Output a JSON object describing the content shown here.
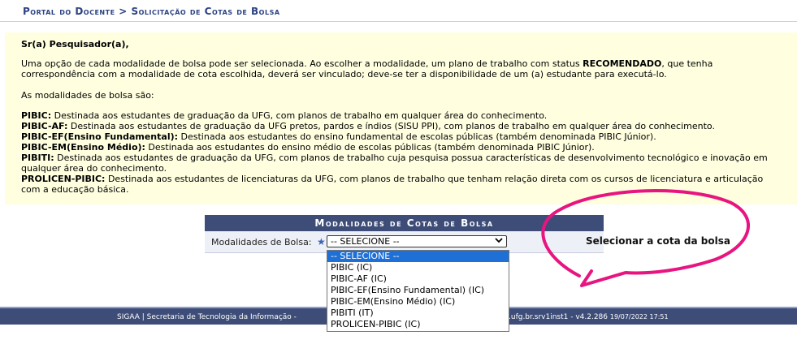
{
  "header": {
    "title": "Portal do Docente > Solicitação de Cotas de Bolsa"
  },
  "info": {
    "greeting": "Sr(a) Pesquisador(a),",
    "intro_before": "Uma opção de cada modalidade de bolsa pode ser selecionada. Ao escolher a modalidade, um plano de trabalho com status ",
    "intro_bold": "RECOMENDADO",
    "intro_after": ", que tenha correspondência com a modalidade de cota escolhida, deverá ser vinculado; deve-se ter a disponibilidade de um (a) estudante para executá-lo.",
    "modalities_heading": "As modalidades de bolsa são:",
    "items": [
      {
        "name": "PIBIC:",
        "desc": " Destinada aos estudantes de graduação da UFG, com planos de trabalho em qualquer área do conhecimento."
      },
      {
        "name": "PIBIC-AF:",
        "desc": " Destinada aos estudantes de graduação da UFG pretos, pardos e índios (SISU PPI), com planos de trabalho em qualquer área do conhecimento."
      },
      {
        "name": "PIBIC-EF(Ensino Fundamental):",
        "desc": " Destinada aos estudantes do ensino fundamental de escolas públicas (também denominada PIBIC Júnior)."
      },
      {
        "name": "PIBIC-EM(Ensino Médio):",
        "desc": " Destinada aos estudantes do ensino médio de escolas públicas (também denominada PIBIC Júnior)."
      },
      {
        "name": "PIBITI:",
        "desc": " Destinada aos estudantes de graduação da UFG, com planos de trabalho cuja pesquisa possua características de desenvolvimento tecnológico e inovação em qualquer área do conhecimento."
      },
      {
        "name": "PROLICEN-PIBIC:",
        "desc": " Destinada aos estudantes de licenciaturas da UFG, com planos de trabalho que tenham relação direta com os cursos de licenciatura e articulação com a educação básica."
      }
    ]
  },
  "panel": {
    "title": "Modalidades de Cotas de Bolsa",
    "field_label": "Modalidades de Bolsa:",
    "required_mark": "★",
    "selected_value": "-- SELECIONE --",
    "options": [
      "-- SELECIONE --",
      "PIBIC (IC)",
      "PIBIC-AF (IC)",
      "PIBIC-EF(Ensino Fundamental) (IC)",
      "PIBIC-EM(Ensino Médio) (IC)",
      "PIBITI (IT)",
      "PROLICEN-PIBIC (IC)"
    ]
  },
  "annotation": {
    "text": "Selecionar a cota da bolsa",
    "color": "#e8147f"
  },
  "footer": {
    "left_text": "SIGAA | Secretaria de Tecnologia da Informação - ",
    "right_text": ".ufg.br.srv1inst1 - v4.2.286 ",
    "date": "19/07/2022 17:51"
  },
  "colors": {
    "header_text": "#2b4283",
    "panel_header_bg": "#3d4d78",
    "info_bg": "#ffffe0",
    "dropdown_selected_bg": "#1e6fd6"
  }
}
